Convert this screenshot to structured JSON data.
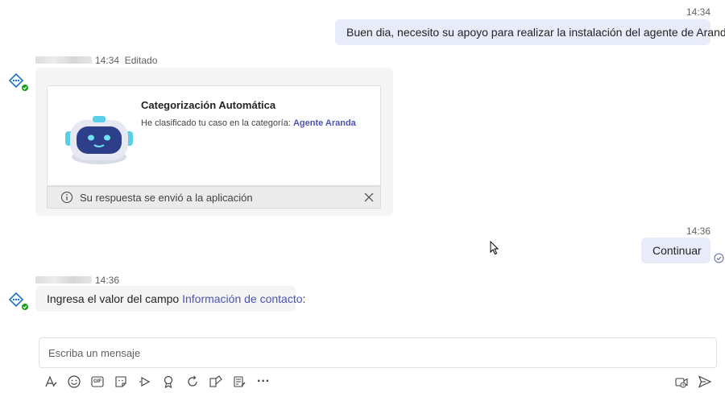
{
  "messages": {
    "m1": {
      "time": "14:34",
      "text": "Buen dia, necesito su apoyo para realizar la instalación del agente de Aranda."
    },
    "m2": {
      "time": "14:34",
      "edited": "Editado",
      "card": {
        "title": "Categorización Automática",
        "text_prefix": "He clasificado tu caso en la categoría: ",
        "category": "Agente Aranda"
      },
      "notice": "Su respuesta se envió a la aplicación"
    },
    "m3": {
      "time": "14:36",
      "text": "Continuar"
    },
    "m4": {
      "time": "14:36",
      "text_prefix": "Ingresa el valor del campo ",
      "field": "Información de contacto",
      "text_suffix": ":"
    }
  },
  "composer": {
    "placeholder": "Escriba un mensaje"
  },
  "toolbar": {
    "format": "format-icon",
    "emoji": "emoji-icon",
    "gif": "GIF",
    "sticker": "sticker-icon",
    "stream": "stream-icon",
    "praise": "praise-icon",
    "loop": "loop-icon",
    "apps": "apps-icon",
    "forms": "forms-icon",
    "more": "···"
  },
  "colors": {
    "accent": "#4f52b2",
    "outgoing_bubble": "#e8ebfa",
    "incoming_bubble": "#f5f5f5",
    "status_green": "#13a10e"
  }
}
